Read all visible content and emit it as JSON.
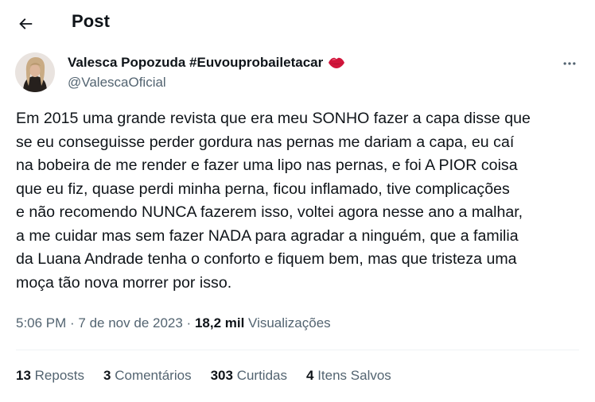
{
  "header": {
    "title": "Post"
  },
  "author": {
    "name": "Valesca Popozuda #Euvouprobailetacar",
    "handle": "@ValescaOficial"
  },
  "tweet": {
    "text": "Em 2015 uma grande revista que era meu SONHO fazer a capa disse que\nse eu conseguisse perder gordura nas pernas me dariam a capa, eu caí\nna bobeira de me render e fazer uma lipo nas pernas, e foi A PIOR coisa\nque eu fiz, quase perdi minha perna, ficou inflamado, tive complicações\ne não recomendo NUNCA fazerem isso, voltei agora nesse ano a malhar,\na me cuidar mas sem fazer NADA para agradar a ninguém, que a familia\nda Luana Andrade tenha o conforto e fiquem bem, mas que tristeza uma\nmoça tão nova morrer por isso."
  },
  "meta": {
    "time": "5:06 PM",
    "separator1": " · ",
    "date": "7 de nov de 2023",
    "separator2": " · ",
    "views_count": "18,2 mil",
    "views_label": " Visualizações"
  },
  "stats": {
    "reposts_count": "13",
    "reposts_label": " Reposts",
    "comments_count": "3",
    "comments_label": " Comentários",
    "likes_count": "303",
    "likes_label": " Curtidas",
    "bookmarks_count": "4",
    "bookmarks_label": " Itens Salvos"
  },
  "icons": {
    "back": "arrow-left-icon",
    "more": "more-horizontal-icon",
    "badge": "lips-icon"
  },
  "colors": {
    "text_primary": "#0f1419",
    "text_secondary": "#536471",
    "divider": "#eff3f4",
    "lips": "#d1153b"
  }
}
